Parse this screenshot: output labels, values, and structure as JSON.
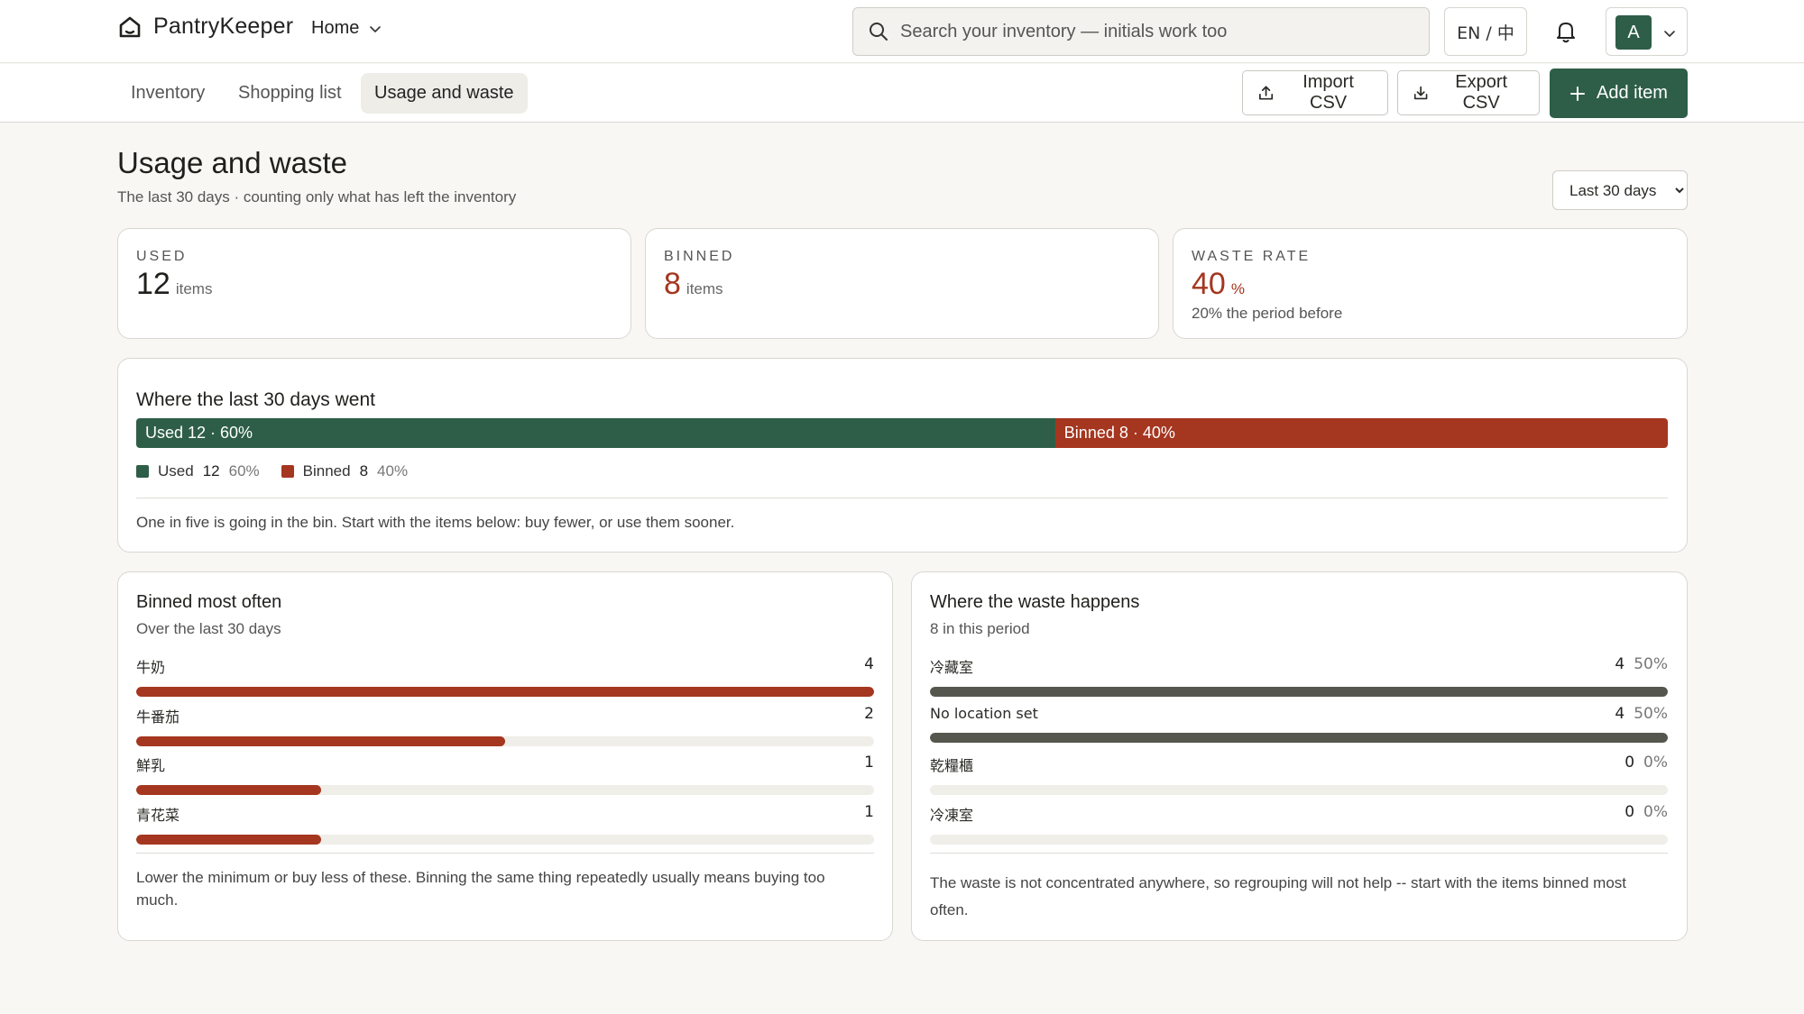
{
  "app": {
    "name": "PantryKeeper",
    "home_label": "Home"
  },
  "search": {
    "placeholder": "Search your inventory — initials work too"
  },
  "lang_toggle": "EN / 中",
  "user": {
    "initial": "A"
  },
  "tabs": [
    {
      "label": "Inventory",
      "active": false
    },
    {
      "label": "Shopping list",
      "active": false
    },
    {
      "label": "Usage and waste",
      "active": true
    }
  ],
  "toolbar": {
    "import_label": "Import CSV",
    "export_label": "Export CSV",
    "add_label": "Add item"
  },
  "page": {
    "title": "Usage and waste",
    "subtitle": "The last 30 days · counting only what has left the inventory",
    "period": "Last 30 days"
  },
  "stats": {
    "used": {
      "label": "USED",
      "value": "12",
      "unit": "items"
    },
    "binned": {
      "label": "BINNED",
      "value": "8",
      "unit": "items"
    },
    "waste_rate": {
      "label": "WASTE RATE",
      "value": "40",
      "unit": "%",
      "note": "20% the period before"
    }
  },
  "split": {
    "title": "Where the last 30 days went",
    "used": {
      "bar_label": "Used 12 · 60%",
      "name": "Used",
      "count": "12",
      "pct": "60%",
      "fraction": 0.6
    },
    "binned": {
      "bar_label": "Binned 8 · 40%",
      "name": "Binned",
      "count": "8",
      "pct": "40%",
      "fraction": 0.4
    },
    "note": "One in five is going in the bin. Start with the items below: buy fewer, or use them sooner."
  },
  "binned_most": {
    "title": "Binned most often",
    "subtitle": "Over the last 30 days",
    "items": [
      {
        "label": "牛奶",
        "value": "4",
        "fraction": 1.0
      },
      {
        "label": "牛番茄",
        "value": "2",
        "fraction": 0.5
      },
      {
        "label": "鮮乳",
        "value": "1",
        "fraction": 0.25
      },
      {
        "label": "青花菜",
        "value": "1",
        "fraction": 0.25
      }
    ],
    "note": "Lower the minimum or buy less of these. Binning the same thing repeatedly usually means buying too much."
  },
  "waste_location": {
    "title": "Where the waste happens",
    "subtitle": "8 in this period",
    "items": [
      {
        "label": "冷藏室",
        "value": "4",
        "pct": "50%",
        "fraction": 1.0
      },
      {
        "label": "No location set",
        "value": "4",
        "pct": "50%",
        "fraction": 1.0
      },
      {
        "label": "乾糧櫃",
        "value": "0",
        "pct": "0%",
        "fraction": 0
      },
      {
        "label": "冷凍室",
        "value": "0",
        "pct": "0%",
        "fraction": 0
      }
    ],
    "note": "The waste is not concentrated anywhere, so regrouping will not help -- start with the items binned most often."
  },
  "colors": {
    "accent": "#2e5e48",
    "waste": "#a5361f",
    "neutral_bar": "#55564d"
  }
}
